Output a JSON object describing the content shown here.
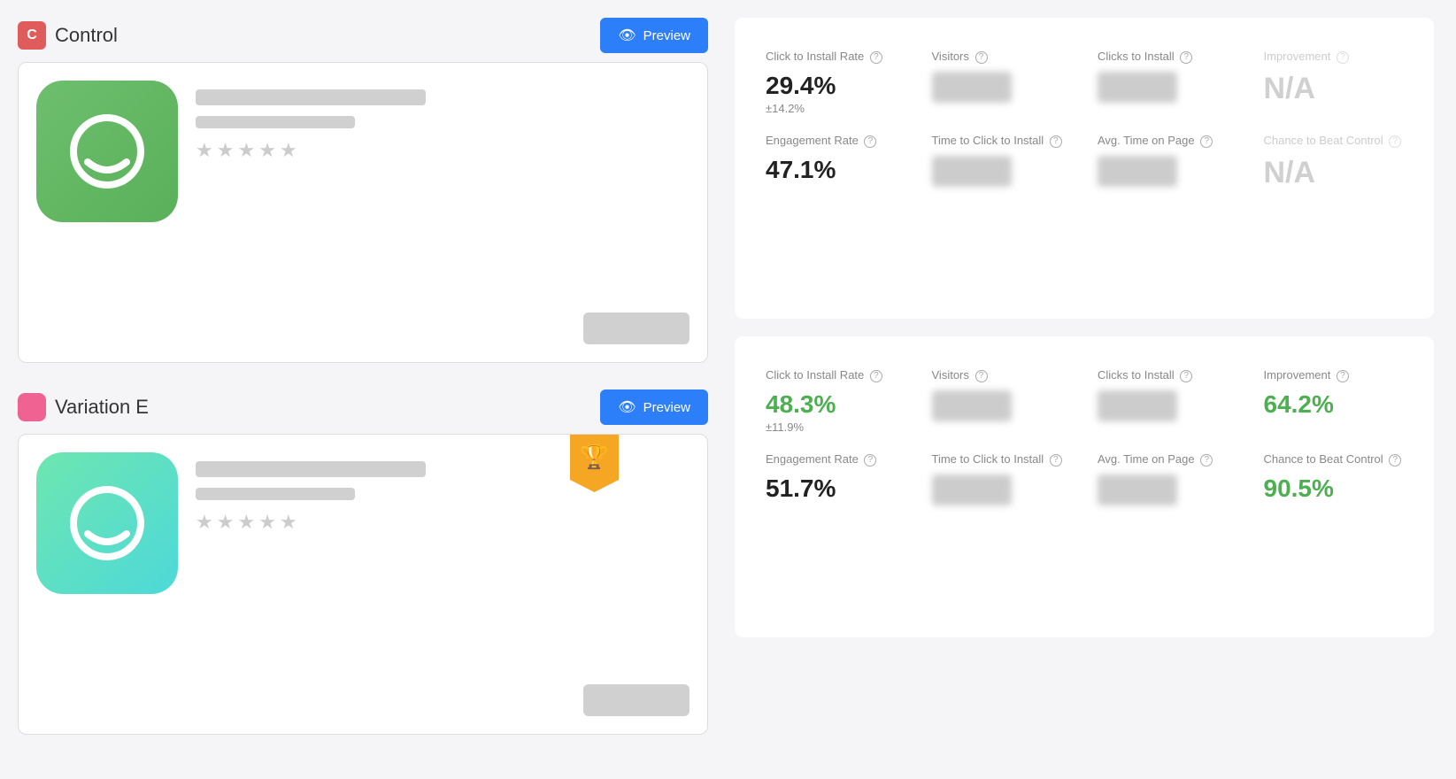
{
  "control": {
    "label": "Control",
    "swatch_letter": "C",
    "swatch_color": "#e05c5c",
    "icon_gradient_start": "#6dbf6d",
    "icon_gradient_end": "#5ab05a",
    "preview_label": "Preview",
    "stats": {
      "click_install_rate_label": "Click to Install Rate",
      "click_install_value": "29.4%",
      "click_install_margin": "±14.2%",
      "visitors_label": "Visitors",
      "clicks_to_install_label": "Clicks to Install",
      "improvement_label": "Improvement",
      "improvement_value": "N/A",
      "engagement_rate_label": "Engagement Rate",
      "engagement_value": "47.1%",
      "time_to_click_label": "Time to Click to Install",
      "avg_time_label": "Avg. Time on Page",
      "chance_beat_label": "Chance to Beat Control",
      "chance_beat_value": "N/A"
    }
  },
  "variation_e": {
    "label": "Variation E",
    "swatch_color": "#f06292",
    "icon_gradient_start": "#6ee6b0",
    "icon_gradient_end": "#4dd9d9",
    "preview_label": "Preview",
    "has_trophy": true,
    "stats": {
      "click_install_rate_label": "Click to Install Rate",
      "click_install_value": "48.3%",
      "click_install_margin": "±11.9%",
      "visitors_label": "Visitors",
      "clicks_to_install_label": "Clicks to Install",
      "improvement_label": "Improvement",
      "improvement_value": "64.2%",
      "engagement_rate_label": "Engagement Rate",
      "engagement_value": "51.7%",
      "time_to_click_label": "Time to Click to Install",
      "avg_time_label": "Avg. Time on Page",
      "chance_beat_label": "Chance to Beat Control",
      "chance_beat_value": "90.5%"
    }
  },
  "icons": {
    "eye": "👁",
    "trophy": "🏆",
    "question": "?"
  }
}
